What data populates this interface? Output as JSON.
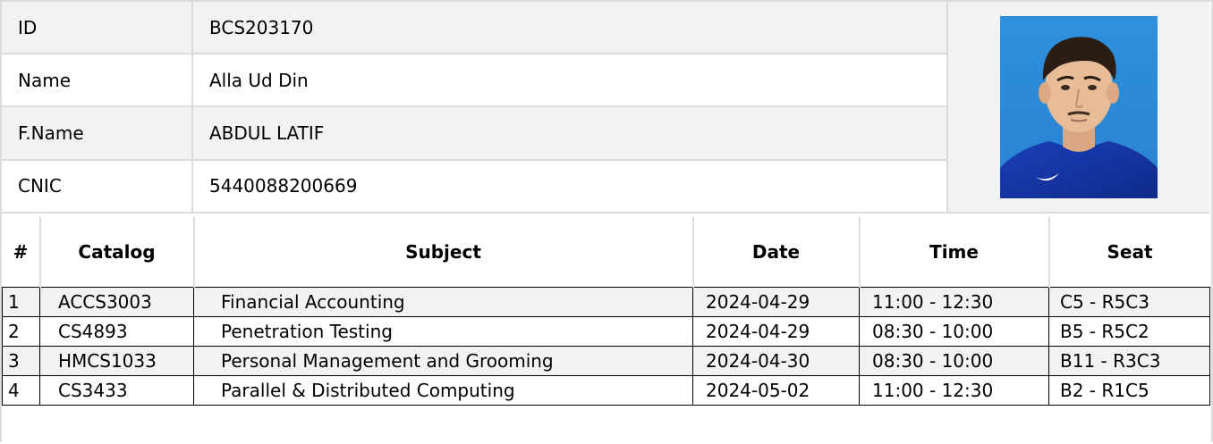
{
  "student": {
    "fields": [
      {
        "label": "ID",
        "value": "BCS203170"
      },
      {
        "label": "Name",
        "value": "Alla Ud Din"
      },
      {
        "label": "F.Name",
        "value": "ABDUL LATIF"
      },
      {
        "label": "CNIC",
        "value": "5440088200669"
      }
    ]
  },
  "exam_table": {
    "headers": {
      "num": "#",
      "catalog": "Catalog",
      "subject": "Subject",
      "date": "Date",
      "time": "Time",
      "seat": "Seat"
    },
    "rows": [
      {
        "num": "1",
        "catalog": "ACCS3003",
        "subject": "Financial Accounting",
        "date": "2024-04-29",
        "time": "11:00 - 12:30",
        "seat": "C5 - R5C3"
      },
      {
        "num": "2",
        "catalog": "CS4893",
        "subject": "Penetration Testing",
        "date": "2024-04-29",
        "time": "08:30 - 10:00",
        "seat": "B5 - R5C2"
      },
      {
        "num": "3",
        "catalog": "HMCS1033",
        "subject": "Personal Management and Grooming",
        "date": "2024-04-30",
        "time": "08:30 - 10:00",
        "seat": "B11 - R3C3"
      },
      {
        "num": "4",
        "catalog": "CS3433",
        "subject": "Parallel & Distributed Computing",
        "date": "2024-05-02",
        "time": "11:00 - 12:30",
        "seat": "B2 - R1C5"
      }
    ]
  },
  "colors": {
    "border": "#dcdcdc",
    "stripe": "#f2f2f2",
    "photo_bg": "#2d8bd8"
  }
}
